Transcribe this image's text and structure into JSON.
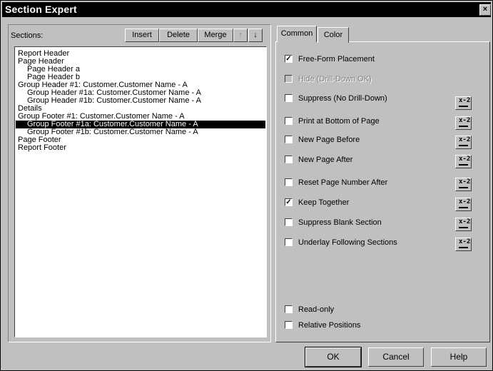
{
  "window": {
    "title": "Section Expert",
    "close_label": "×"
  },
  "sections": {
    "label": "Sections:",
    "toolbar": {
      "insert": "Insert",
      "delete": "Delete",
      "merge": "Merge",
      "up": "↑",
      "down": "↓"
    },
    "items": [
      "Report Header",
      "Page Header",
      "Page Header a",
      "Page Header b",
      "Group Header #1: Customer.Customer Name - A",
      "Group Header #1a: Customer.Customer Name - A",
      "Group Header #1b: Customer.Customer Name - A",
      "Details",
      "Group Footer #1: Customer.Customer Name - A",
      "Group Footer #1a: Customer.Customer Name - A",
      "Group Footer #1b: Customer.Customer Name - A",
      "Page Footer",
      "Report Footer"
    ],
    "selected_index": 9
  },
  "tabs": [
    "Common",
    "Color"
  ],
  "active_tab": "Common",
  "options": [
    {
      "label": "Free-Form Placement",
      "checked": true,
      "disabled": false
    },
    {
      "label": "Hide (Drill-Down OK)",
      "checked": false,
      "disabled": true
    },
    {
      "label": "Suppress (No Drill-Down)",
      "checked": false,
      "disabled": false,
      "formula": true
    },
    {
      "label": "Print at Bottom of Page",
      "checked": false,
      "disabled": false,
      "formula": true
    },
    {
      "label": "New Page Before",
      "checked": false,
      "disabled": false,
      "formula": true
    },
    {
      "label": "New Page After",
      "checked": false,
      "disabled": false,
      "formula": true
    },
    {
      "label": "Reset Page Number After",
      "checked": false,
      "disabled": false,
      "formula": true
    },
    {
      "label": "Keep Together",
      "checked": true,
      "disabled": false,
      "formula": true
    },
    {
      "label": "Suppress Blank Section",
      "checked": false,
      "disabled": false,
      "formula": true
    },
    {
      "label": "Underlay Following Sections",
      "checked": false,
      "disabled": false,
      "formula": true
    },
    {
      "label": "Read-only",
      "checked": false,
      "disabled": false
    },
    {
      "label": "Relative Positions",
      "checked": false,
      "disabled": false
    }
  ],
  "formula_button_label": "x-2",
  "buttons": {
    "ok": "OK",
    "cancel": "Cancel",
    "help": "Help"
  }
}
